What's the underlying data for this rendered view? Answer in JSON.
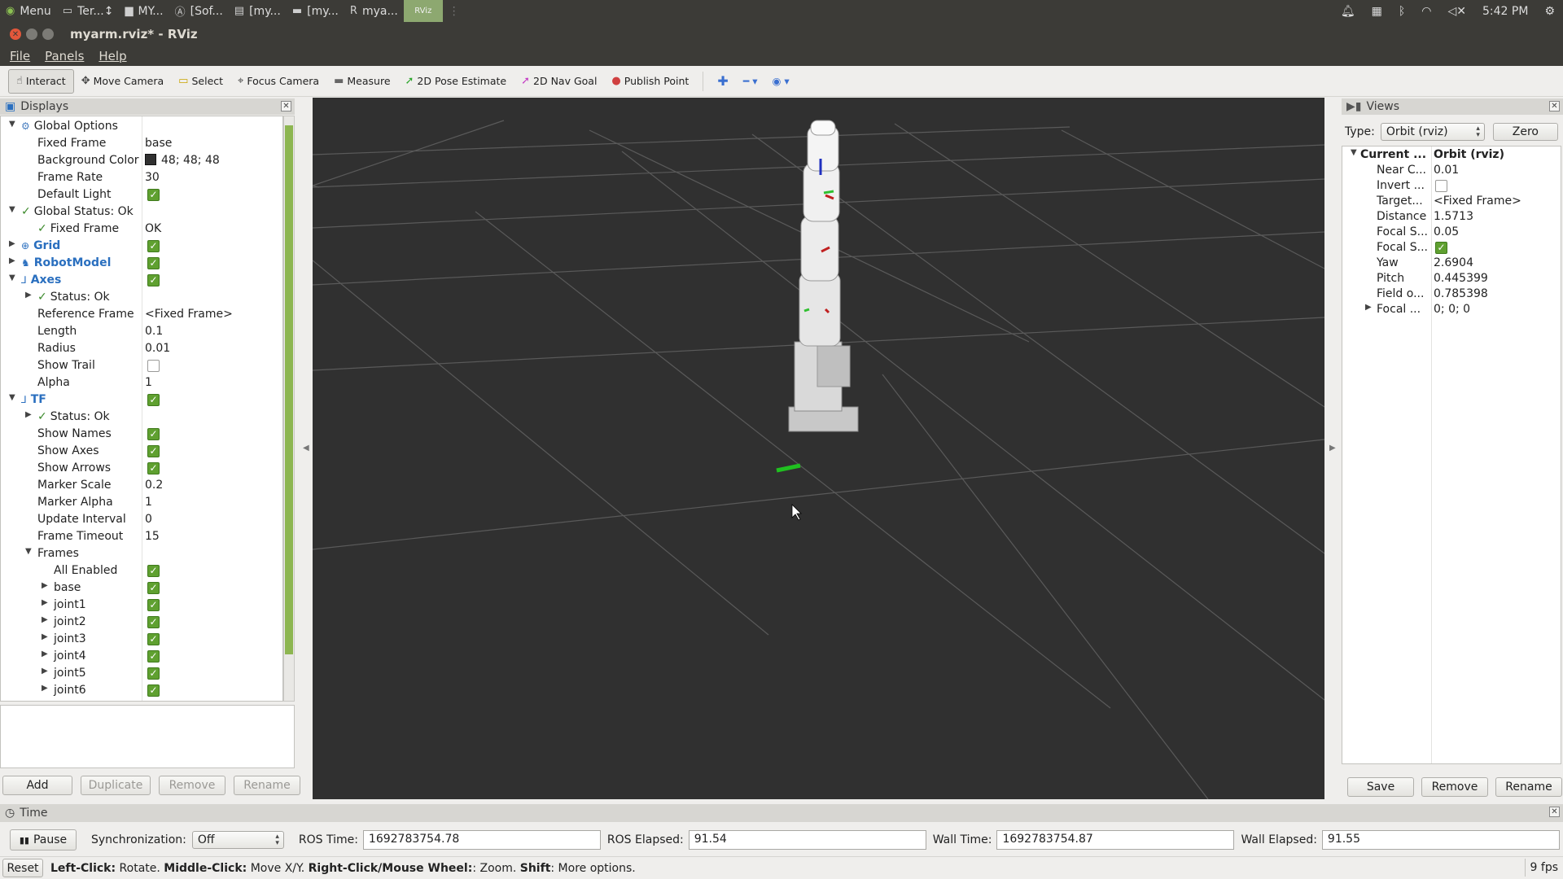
{
  "system_panel": {
    "menu_label": "Menu",
    "tasks": [
      {
        "icon": "terminal-icon",
        "glyph": "▭",
        "label": "Ter...↕"
      },
      {
        "icon": "folder-icon",
        "glyph": "▆",
        "label": "MY..."
      },
      {
        "icon": "software-icon",
        "glyph": "Ⓐ",
        "label": "[Sof..."
      },
      {
        "icon": "editor-icon",
        "glyph": "▤",
        "label": "[my..."
      },
      {
        "icon": "window-icon",
        "glyph": "▬",
        "label": "[my..."
      },
      {
        "icon": "rviz-icon",
        "glyph": "R",
        "label": "mya..."
      }
    ],
    "active_task_label": "RViz",
    "clock": "5:42 PM"
  },
  "window": {
    "title": "myarm.rviz* - RViz"
  },
  "menubar": [
    "File",
    "Panels",
    "Help"
  ],
  "toolbar": {
    "tools": [
      {
        "name": "interact",
        "label": "Interact",
        "icon": "hand-pointer-icon",
        "glyph": "☝",
        "color": "#444444"
      },
      {
        "name": "move-camera",
        "label": "Move Camera",
        "icon": "move-icon",
        "glyph": "✥",
        "color": "#444444"
      },
      {
        "name": "select",
        "label": "Select",
        "icon": "select-box-icon",
        "glyph": "▭",
        "color": "#c9a400"
      },
      {
        "name": "focus-camera",
        "label": "Focus Camera",
        "icon": "crosshair-icon",
        "glyph": "⌖",
        "color": "#444444"
      },
      {
        "name": "measure",
        "label": "Measure",
        "icon": "ruler-icon",
        "glyph": "▬",
        "color": "#666666"
      },
      {
        "name": "2d-pose-estimate",
        "label": "2D Pose Estimate",
        "icon": "green-arrow-icon",
        "glyph": "➚",
        "color": "#2aa52a"
      },
      {
        "name": "2d-nav-goal",
        "label": "2D Nav Goal",
        "icon": "pink-arrow-icon",
        "glyph": "➚",
        "color": "#c43cc4"
      },
      {
        "name": "publish-point",
        "label": "Publish Point",
        "icon": "map-pin-icon",
        "glyph": "●",
        "color": "#d04040"
      }
    ]
  },
  "displays_panel": {
    "title": "Displays",
    "rows": [
      {
        "indent": 0,
        "expander": "▼",
        "icon": "gear-icon",
        "icon_glyph": "⚙",
        "label": "Global Options",
        "style": "normal"
      },
      {
        "indent": 1,
        "label": "Fixed Frame",
        "value": "base"
      },
      {
        "indent": 1,
        "label": "Background Color",
        "value": "48; 48; 48",
        "swatch": "#303030"
      },
      {
        "indent": 1,
        "label": "Frame Rate",
        "value": "30"
      },
      {
        "indent": 1,
        "label": "Default Light",
        "check": true
      },
      {
        "indent": 0,
        "expander": "▼",
        "ok": true,
        "label": "Global Status: Ok"
      },
      {
        "indent": 1,
        "ok": true,
        "label": "Fixed Frame",
        "value": "OK"
      },
      {
        "indent": 0,
        "expander": "▶",
        "icon": "grid-icon",
        "icon_glyph": "⊕",
        "label": "Grid",
        "style": "blue",
        "check": true
      },
      {
        "indent": 0,
        "expander": "▶",
        "icon": "robot-icon",
        "icon_glyph": "♞",
        "label": "RobotModel",
        "style": "blue",
        "check": true
      },
      {
        "indent": 0,
        "expander": "▼",
        "icon": "axes-icon",
        "icon_glyph": "⅃",
        "label": "Axes",
        "style": "blue",
        "check": true
      },
      {
        "indent": 1,
        "expander": "▶",
        "ok": true,
        "label": "Status: Ok"
      },
      {
        "indent": 1,
        "label": "Reference Frame",
        "value": "<Fixed Frame>"
      },
      {
        "indent": 1,
        "label": "Length",
        "value": "0.1"
      },
      {
        "indent": 1,
        "label": "Radius",
        "value": "0.01"
      },
      {
        "indent": 1,
        "label": "Show Trail",
        "check": false
      },
      {
        "indent": 1,
        "label": "Alpha",
        "value": "1"
      },
      {
        "indent": 0,
        "expander": "▼",
        "icon": "tf-icon",
        "icon_glyph": "⅃",
        "label": "TF",
        "style": "blue",
        "check": true
      },
      {
        "indent": 1,
        "expander": "▶",
        "ok": true,
        "label": "Status: Ok"
      },
      {
        "indent": 1,
        "label": "Show Names",
        "check": true
      },
      {
        "indent": 1,
        "label": "Show Axes",
        "check": true
      },
      {
        "indent": 1,
        "label": "Show Arrows",
        "check": true
      },
      {
        "indent": 1,
        "label": "Marker Scale",
        "value": "0.2"
      },
      {
        "indent": 1,
        "label": "Marker Alpha",
        "value": "1"
      },
      {
        "indent": 1,
        "label": "Update Interval",
        "value": "0"
      },
      {
        "indent": 1,
        "label": "Frame Timeout",
        "value": "15"
      },
      {
        "indent": 1,
        "expander": "▼",
        "label": "Frames"
      },
      {
        "indent": 2,
        "label": "All Enabled",
        "check": true
      },
      {
        "indent": 2,
        "expander": "▶",
        "label": "base",
        "check": true
      },
      {
        "indent": 2,
        "expander": "▶",
        "label": "joint1",
        "check": true
      },
      {
        "indent": 2,
        "expander": "▶",
        "label": "joint2",
        "check": true
      },
      {
        "indent": 2,
        "expander": "▶",
        "label": "joint3",
        "check": true
      },
      {
        "indent": 2,
        "expander": "▶",
        "label": "joint4",
        "check": true
      },
      {
        "indent": 2,
        "expander": "▶",
        "label": "joint5",
        "check": true
      },
      {
        "indent": 2,
        "expander": "▶",
        "label": "joint6",
        "check": true
      }
    ],
    "buttons": [
      {
        "name": "add",
        "label": "Add",
        "enabled": true
      },
      {
        "name": "duplicate",
        "label": "Duplicate",
        "enabled": false
      },
      {
        "name": "remove",
        "label": "Remove",
        "enabled": false
      },
      {
        "name": "rename",
        "label": "Rename",
        "enabled": false
      }
    ]
  },
  "views_panel": {
    "title": "Views",
    "type_label": "Type:",
    "type_value": "Orbit (rviz)",
    "zero_label": "Zero",
    "rows": [
      {
        "label": "Current ...",
        "value": "Orbit (rviz)",
        "header": true
      },
      {
        "label": "Near C...",
        "value": "0.01"
      },
      {
        "label": "Invert ...",
        "check": false
      },
      {
        "label": "Target...",
        "value": "<Fixed Frame>"
      },
      {
        "label": "Distance",
        "value": "1.5713"
      },
      {
        "label": "Focal S...",
        "value": "0.05"
      },
      {
        "label": "Focal S...",
        "check": true
      },
      {
        "label": "Yaw",
        "value": "2.6904"
      },
      {
        "label": "Pitch",
        "value": "0.445399"
      },
      {
        "label": "Field o...",
        "value": "0.785398"
      },
      {
        "label": "Focal ...",
        "value": "0; 0; 0",
        "expander": "▶"
      }
    ],
    "buttons": {
      "save": "Save",
      "remove": "Remove",
      "rename": "Rename"
    }
  },
  "time_panel": {
    "title": "Time",
    "pause_label": "Pause",
    "sync_label": "Synchronization:",
    "sync_value": "Off",
    "ros_time_label": "ROS Time:",
    "ros_time": "1692783754.78",
    "ros_elapsed_label": "ROS Elapsed:",
    "ros_elapsed": "91.54",
    "wall_time_label": "Wall Time:",
    "wall_time": "1692783754.87",
    "wall_elapsed_label": "Wall Elapsed:",
    "wall_elapsed": "91.55"
  },
  "statusbar": {
    "reset_label": "Reset",
    "hints": [
      {
        "key": "Left-Click:",
        "text": " Rotate. "
      },
      {
        "key": "Middle-Click:",
        "text": " Move X/Y. "
      },
      {
        "key": "Right-Click/Mouse Wheel:",
        "text": ": Zoom. "
      },
      {
        "key": "Shift",
        "text": ": More options."
      }
    ],
    "fps": "9 fps"
  }
}
